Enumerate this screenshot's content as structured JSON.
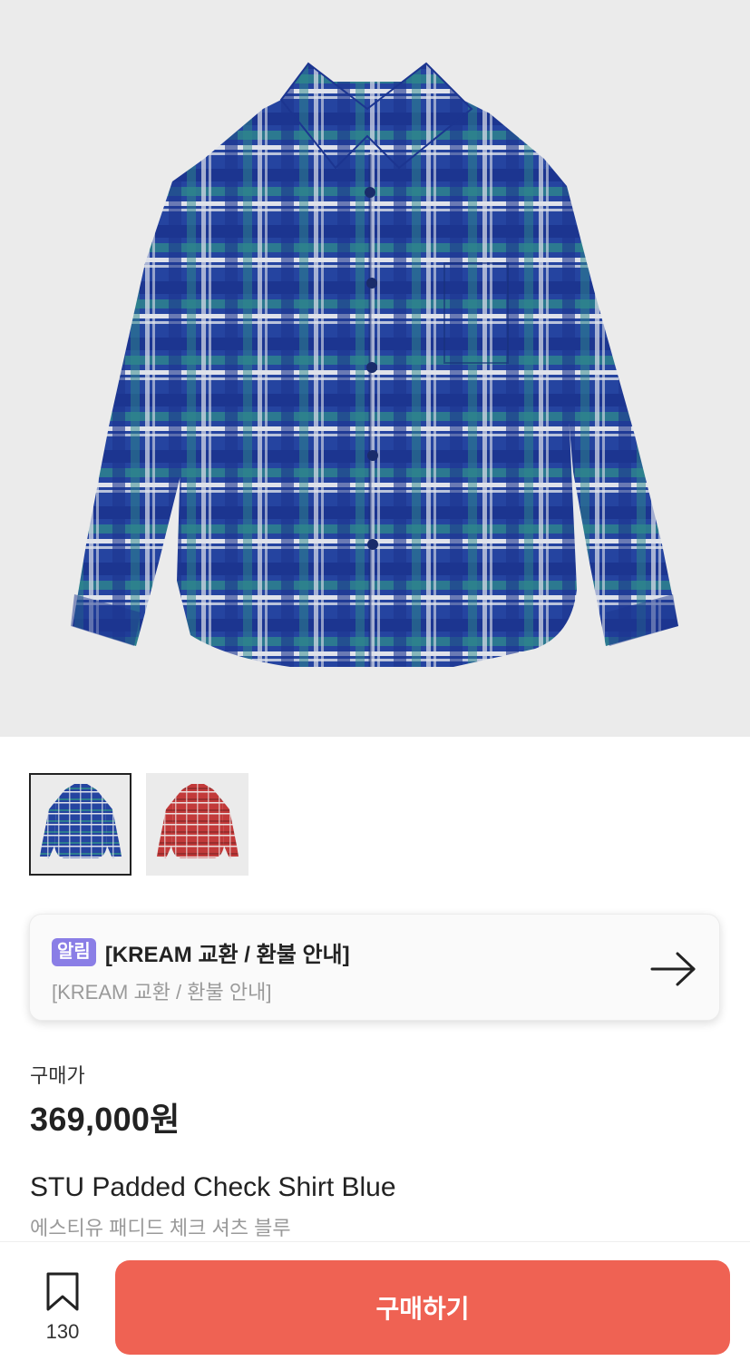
{
  "colors": {
    "hero_bg": "#ebebeb",
    "badge_bg": "#8a7ee6",
    "buy_button": "#ef6253",
    "shirt_blue": "#2544a0",
    "shirt_red": "#c23a3a"
  },
  "hero": {
    "image_icon": "plaid-shirt-blue-image"
  },
  "thumbnails": [
    {
      "icon": "plaid-shirt-blue-thumb",
      "selected": true
    },
    {
      "icon": "plaid-shirt-red-thumb",
      "selected": false
    }
  ],
  "notice": {
    "badge": "알림",
    "title": "[KREAM 교환 / 환불 안내]",
    "subtitle": "[KREAM 교환 / 환불 안내]",
    "icon": "arrow-right-icon"
  },
  "price": {
    "label": "구매가",
    "value": "369,000원"
  },
  "product": {
    "name": "STU Padded Check Shirt Blue",
    "name_ko": "에스티유 패디드 체크 셔츠 블루"
  },
  "bottom_bar": {
    "bookmark_icon": "bookmark-icon",
    "bookmark_count": "130",
    "buy_label": "구매하기"
  }
}
